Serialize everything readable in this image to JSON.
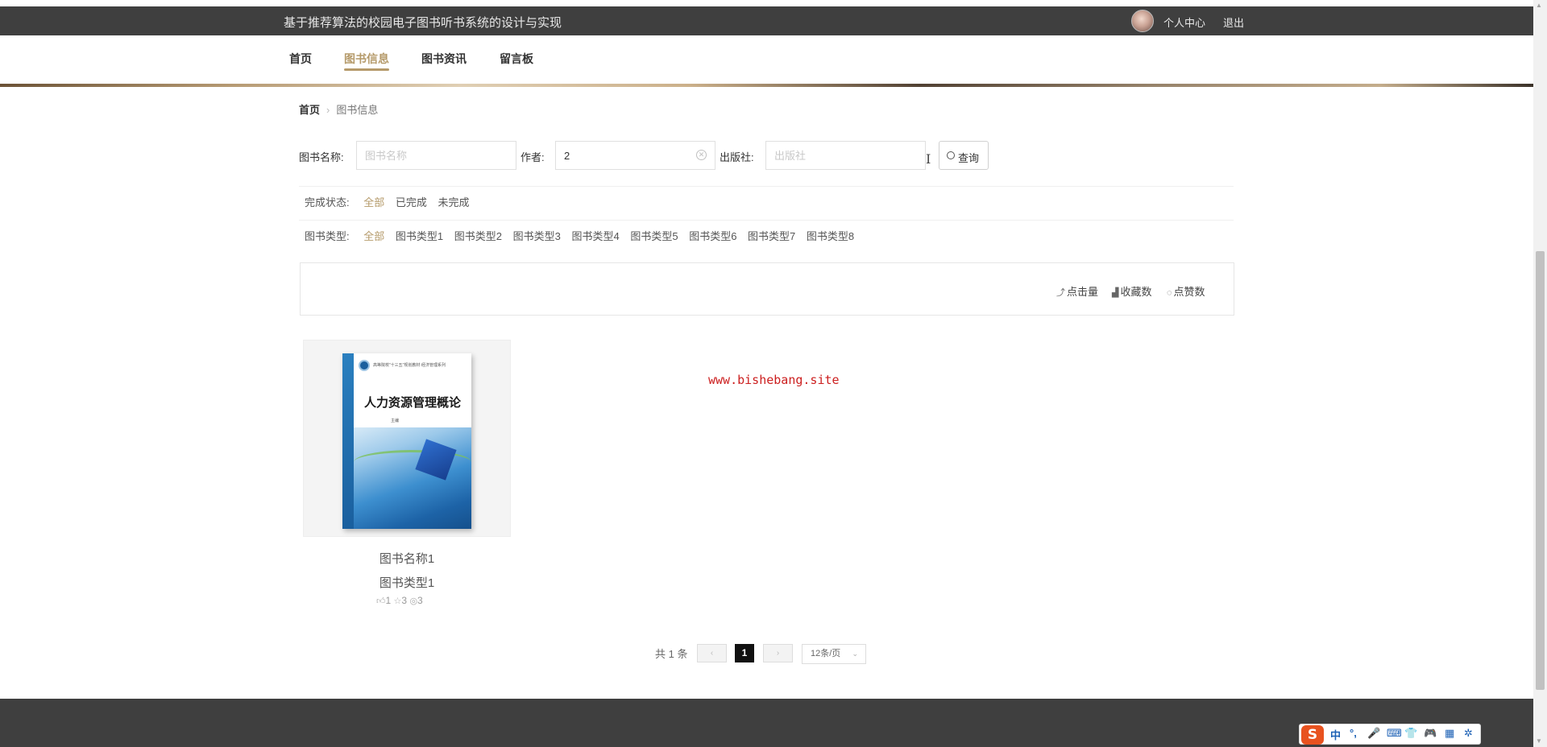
{
  "header": {
    "site_title": "基于推荐算法的校园电子图书听书系统的设计与实现",
    "user_center": "个人中心",
    "logout": "退出"
  },
  "nav": {
    "items": [
      "首页",
      "图书信息",
      "图书资讯",
      "留言板"
    ],
    "active": "图书信息"
  },
  "breadcrumb": {
    "home": "首页",
    "separator": "›",
    "current": "图书信息"
  },
  "search": {
    "name_label": "图书名称:",
    "name_placeholder": "图书名称",
    "name_value": "",
    "author_label": "作者:",
    "author_value": "2",
    "publisher_label": "出版社:",
    "publisher_placeholder": "出版社",
    "publisher_value": "",
    "button": "查询"
  },
  "filters": {
    "status": {
      "title": "完成状态:",
      "options": [
        "全部",
        "已完成",
        "未完成"
      ],
      "active": "全部"
    },
    "type": {
      "title": "图书类型:",
      "options": [
        "全部",
        "图书类型1",
        "图书类型2",
        "图书类型3",
        "图书类型4",
        "图书类型5",
        "图书类型6",
        "图书类型7",
        "图书类型8"
      ],
      "active": "全部"
    }
  },
  "sort": {
    "clicks": "点击量",
    "favorites": "收藏数",
    "likes": "点赞数"
  },
  "books": [
    {
      "name": "图书名称1",
      "type": "图书类型1",
      "likes": "1",
      "stars": "3",
      "views": "3",
      "cover": {
        "title": "人力资源管理概论",
        "series": "高等院校“十三五”规划教材·经济管理系列",
        "authors": "主编"
      }
    }
  ],
  "watermark": "www.bishebang.site",
  "pagination": {
    "total": "共 1 条",
    "prev": "‹",
    "current": "1",
    "next": "›",
    "page_size": "12条/页"
  },
  "ime": {
    "logo": "S",
    "items": [
      "中",
      "°,",
      "🎤",
      "⌨",
      "👕",
      "🎮",
      "▦",
      "✲"
    ]
  },
  "colors": {
    "accent": "#b59a6a",
    "topbar": "#3f3f3f",
    "watermark": "#cc1f1f"
  }
}
